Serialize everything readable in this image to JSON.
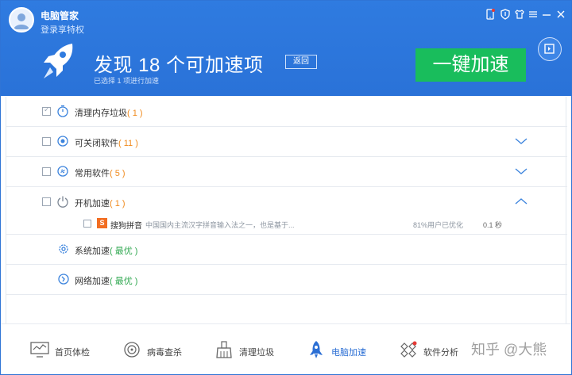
{
  "header": {
    "app_title": "电脑管家",
    "login_link": "登录享特权",
    "headline": "发现 18 个可加速项",
    "sub_headline": "已选择 1 项进行加速",
    "back_button": "返回",
    "boost_button": "一键加速",
    "accent_color": "#2f7be0",
    "boost_color": "#19bd5c"
  },
  "window_controls": [
    "phone-icon",
    "shield-icon",
    "shirt-icon",
    "menu-icon",
    "minimize-icon",
    "close-icon"
  ],
  "items": [
    {
      "label": "清理内存垃圾",
      "count": "( 1 )",
      "checked": true,
      "icon": "timer-icon"
    },
    {
      "label": "可关闭软件",
      "count": "( 11 )",
      "checked": false,
      "icon": "target-icon",
      "chevron": "down"
    },
    {
      "label": "常用软件",
      "count": "( 5 )",
      "checked": false,
      "icon": "link-icon",
      "chevron": "down"
    },
    {
      "label": "开机加速",
      "count": "( 1 )",
      "checked": false,
      "icon": "power-icon",
      "chevron": "up"
    }
  ],
  "sub_item": {
    "name": "搜狗拼音",
    "description": "中国国内主流汉字拼音输入法之一，也是基于...",
    "percent": "81%用户已优化",
    "time": "0.1 秒"
  },
  "system_rows": [
    {
      "label": "系统加速",
      "status": "( 最优 )",
      "icon": "gear-icon"
    },
    {
      "label": "网络加速",
      "status": "( 最优 )",
      "icon": "network-icon"
    }
  ],
  "nav": [
    {
      "label": "首页体检",
      "icon": "monitor-icon",
      "active": false
    },
    {
      "label": "病毒查杀",
      "icon": "crosshair-icon",
      "active": false
    },
    {
      "label": "清理垃圾",
      "icon": "broom-icon",
      "active": false
    },
    {
      "label": "电脑加速",
      "icon": "rocket-icon",
      "active": true
    },
    {
      "label": "软件分析",
      "icon": "apps-icon",
      "active": false
    }
  ],
  "watermark": "知乎 @大熊"
}
